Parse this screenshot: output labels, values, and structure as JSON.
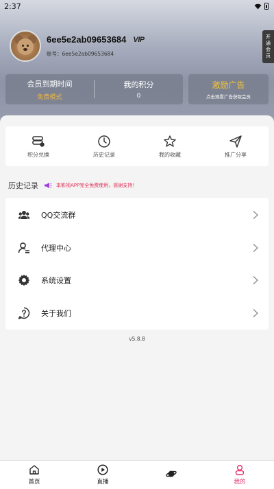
{
  "status": {
    "time": "2:37"
  },
  "profile": {
    "username": "6ee5e2ab09653684",
    "vip_label": "VIP",
    "account_line": "账号：6ee5e2ab09653684"
  },
  "open_member": [
    "开",
    "通",
    "会",
    "员"
  ],
  "stats": {
    "expiry_title": "会员到期时间",
    "expiry_value": "免费模式",
    "points_title": "我的积分",
    "points_value": "0"
  },
  "ad": {
    "title": "激励广告",
    "subtitle": "点击观看广告获取会员"
  },
  "quick_actions": [
    {
      "label": "积分兑换",
      "icon": "coin-stack-icon"
    },
    {
      "label": "历史记录",
      "icon": "clock-icon"
    },
    {
      "label": "我的收藏",
      "icon": "star-icon"
    },
    {
      "label": "推广分享",
      "icon": "paper-plane-icon"
    }
  ],
  "history": {
    "title": "历史记录",
    "notice": "本影视APP完全免费使用，感谢支持！"
  },
  "menu": [
    {
      "label": "QQ交流群",
      "icon": "group-icon"
    },
    {
      "label": "代理中心",
      "icon": "agent-user-icon"
    },
    {
      "label": "系统设置",
      "icon": "gear-icon"
    },
    {
      "label": "关于我们",
      "icon": "question-icon"
    }
  ],
  "version": "v5.8.8",
  "tabs": [
    {
      "label": "首页",
      "icon": "home-icon",
      "active": false
    },
    {
      "label": "直播",
      "icon": "play-circle-icon",
      "active": false
    },
    {
      "label": "",
      "icon": "planet-icon",
      "active": false
    },
    {
      "label": "我的",
      "icon": "user-icon",
      "active": true
    }
  ],
  "colors": {
    "accent_pink": "#e8306e",
    "gold": "#f0b63c",
    "notice_red": "#e02a55"
  }
}
